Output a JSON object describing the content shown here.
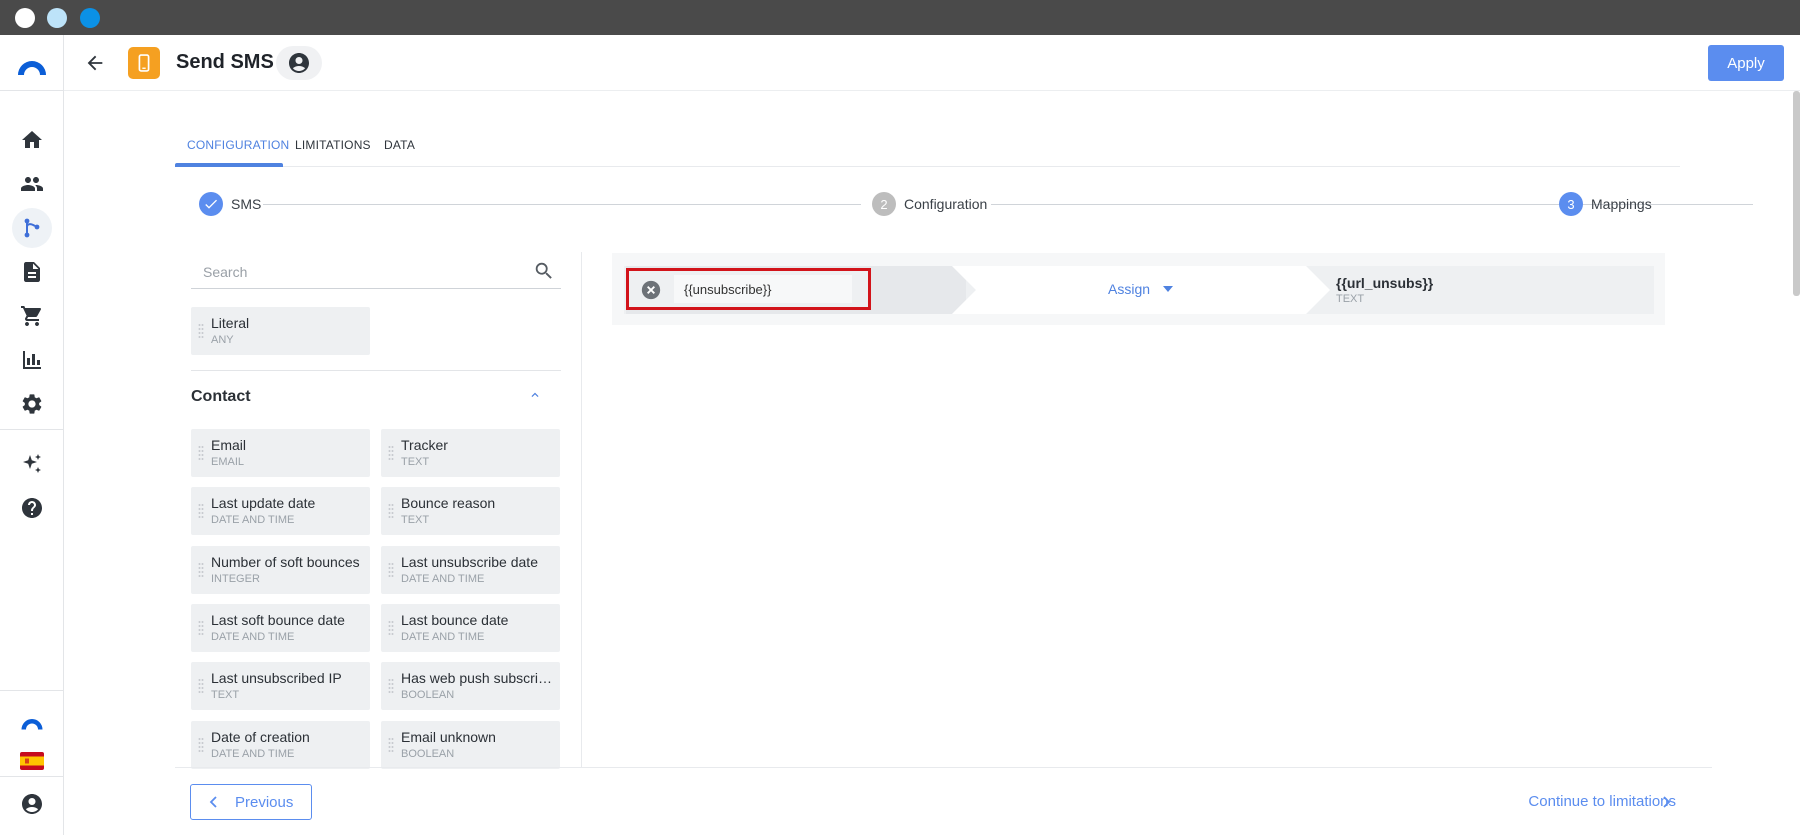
{
  "window": {
    "title_dots": [
      "close",
      "minimize",
      "maximize"
    ]
  },
  "rail": {
    "items": [
      {
        "name": "home",
        "icon": "home-icon"
      },
      {
        "name": "contacts",
        "icon": "people-icon"
      },
      {
        "name": "automation",
        "icon": "flow-icon",
        "active": true
      },
      {
        "name": "content",
        "icon": "document-icon"
      },
      {
        "name": "commerce",
        "icon": "cart-icon"
      },
      {
        "name": "reports",
        "icon": "bar-chart-icon"
      },
      {
        "name": "settings",
        "icon": "gear-icon"
      },
      {
        "name": "ai",
        "icon": "sparkles-icon"
      },
      {
        "name": "help",
        "icon": "help-icon"
      }
    ],
    "bottom": [
      {
        "name": "brand",
        "icon": "brand-logo-icon"
      },
      {
        "name": "language",
        "icon": "spain-flag-icon"
      },
      {
        "name": "account",
        "icon": "account-icon"
      }
    ]
  },
  "header": {
    "title": "Send SMS",
    "apply_label": "Apply"
  },
  "tabs": [
    {
      "label": "CONFIGURATION",
      "active": true
    },
    {
      "label": "LIMITATIONS",
      "active": false
    },
    {
      "label": "DATA",
      "active": false
    }
  ],
  "stepper": {
    "steps": [
      {
        "number": "1",
        "label": "SMS",
        "state": "done"
      },
      {
        "number": "2",
        "label": "Configuration",
        "state": "pending"
      },
      {
        "number": "3",
        "label": "Mappings",
        "state": "current"
      }
    ]
  },
  "fields_panel": {
    "search_placeholder": "Search",
    "literal": {
      "name": "Literal",
      "type": "ANY"
    },
    "group_title": "Contact",
    "fields": [
      {
        "name": "Email",
        "type": "EMAIL"
      },
      {
        "name": "Tracker",
        "type": "TEXT"
      },
      {
        "name": "Last update date",
        "type": "DATE AND TIME"
      },
      {
        "name": "Bounce reason",
        "type": "TEXT"
      },
      {
        "name": "Number of soft bounces",
        "type": "INTEGER"
      },
      {
        "name": "Last unsubscribe date",
        "type": "DATE AND TIME"
      },
      {
        "name": "Last soft bounce date",
        "type": "DATE AND TIME"
      },
      {
        "name": "Last bounce date",
        "type": "DATE AND TIME"
      },
      {
        "name": "Last unsubscribed IP",
        "type": "TEXT"
      },
      {
        "name": "Has web push subscrip…",
        "type": "BOOLEAN"
      },
      {
        "name": "Date of creation",
        "type": "DATE AND TIME"
      },
      {
        "name": "Email unknown",
        "type": "BOOLEAN"
      }
    ]
  },
  "mapping": {
    "source_value": "{{unsubscribe}}",
    "operation": "Assign",
    "target_name": "{{url_unsubs}}",
    "target_type": "TEXT"
  },
  "footer": {
    "previous_label": "Previous",
    "next_label": "Continue to limitations"
  },
  "colors": {
    "accent": "#5b8def",
    "app_icon": "#f5a021",
    "highlight": "#d2131a"
  }
}
